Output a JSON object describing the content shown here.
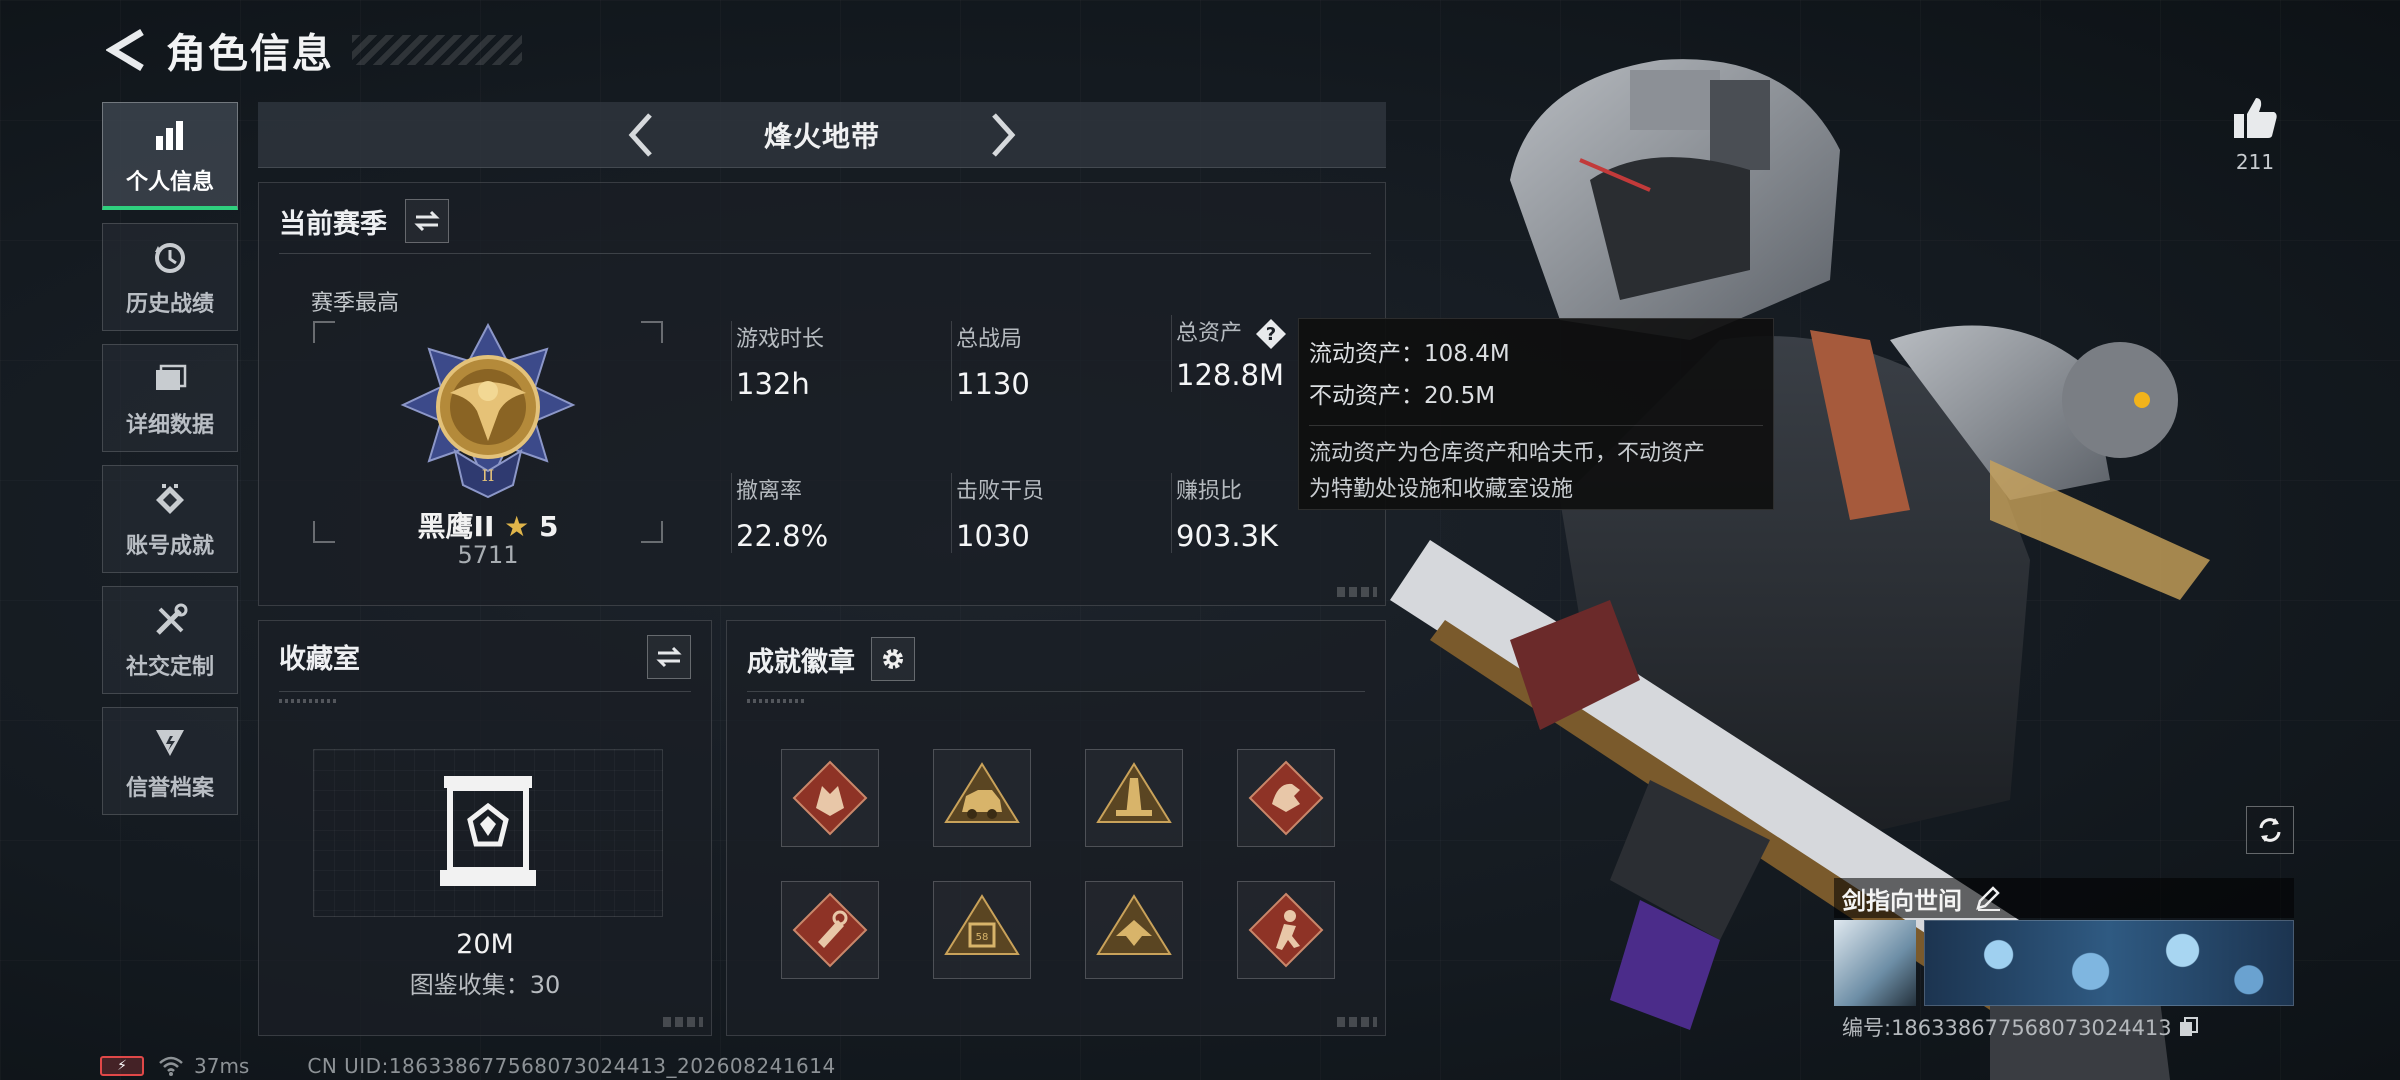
{
  "header": {
    "title": "角色信息"
  },
  "sidebar": {
    "items": [
      {
        "label": "个人信息",
        "icon": "bar-chart-icon",
        "active": true
      },
      {
        "label": "历史战绩",
        "icon": "history-clock-icon",
        "active": false
      },
      {
        "label": "详细数据",
        "icon": "folder-icon",
        "active": false
      },
      {
        "label": "账号成就",
        "icon": "achievement-diamond-icon",
        "active": false
      },
      {
        "label": "社交定制",
        "icon": "wrench-screwdriver-icon",
        "active": false
      },
      {
        "label": "信誉档案",
        "icon": "reputation-shield-icon",
        "active": false
      }
    ]
  },
  "mode": {
    "title": "烽火地带"
  },
  "season": {
    "title": "当前赛季",
    "best_label": "赛季最高",
    "rank_name": "黑鹰II",
    "rank_stars": "5",
    "rank_score": "5711",
    "stats": [
      {
        "label": "游戏时长",
        "value": "132h"
      },
      {
        "label": "总战局",
        "value": "1130"
      },
      {
        "label": "总资产",
        "value": "128.8M"
      },
      {
        "label": "撤离率",
        "value": "22.8%"
      },
      {
        "label": "击败干员",
        "value": "1030"
      },
      {
        "label": "赚损比",
        "value": "903.3K"
      }
    ]
  },
  "tooltip": {
    "liquid": "流动资产：108.4M",
    "fixed": "不动资产：20.5M",
    "desc_line1": "流动资产为仓库资产和哈夫币，不动资产",
    "desc_line2": "为特勤处设施和收藏室设施"
  },
  "collection": {
    "title": "收藏室",
    "value": "20M",
    "count": "图鉴收集：30"
  },
  "badges": {
    "title": "成就徽章",
    "items": [
      {
        "icon": "wolf-badge-icon",
        "tone": "red"
      },
      {
        "icon": "vehicle-badge-icon",
        "tone": "gold"
      },
      {
        "icon": "tower-badge-icon",
        "tone": "gold"
      },
      {
        "icon": "dragon-badge-icon",
        "tone": "red"
      },
      {
        "icon": "tool-badge-icon",
        "tone": "red"
      },
      {
        "icon": "crate-badge-icon",
        "tone": "gold"
      },
      {
        "icon": "eagle-badge-icon",
        "tone": "gold"
      },
      {
        "icon": "soldier-badge-icon",
        "tone": "red"
      }
    ]
  },
  "profile": {
    "likes": "211",
    "player_name": "剑指向世间",
    "id_text": "编号:1863386775680730244​13"
  },
  "status": {
    "ping": "37ms",
    "uid": "CN UID:1863386775680730244​13_202608241614"
  },
  "colors": {
    "accent_green": "#2fd07e",
    "badge_red": "#a03a2c",
    "badge_gold": "#c9a25a",
    "gold_medal": "#c89a3c"
  }
}
